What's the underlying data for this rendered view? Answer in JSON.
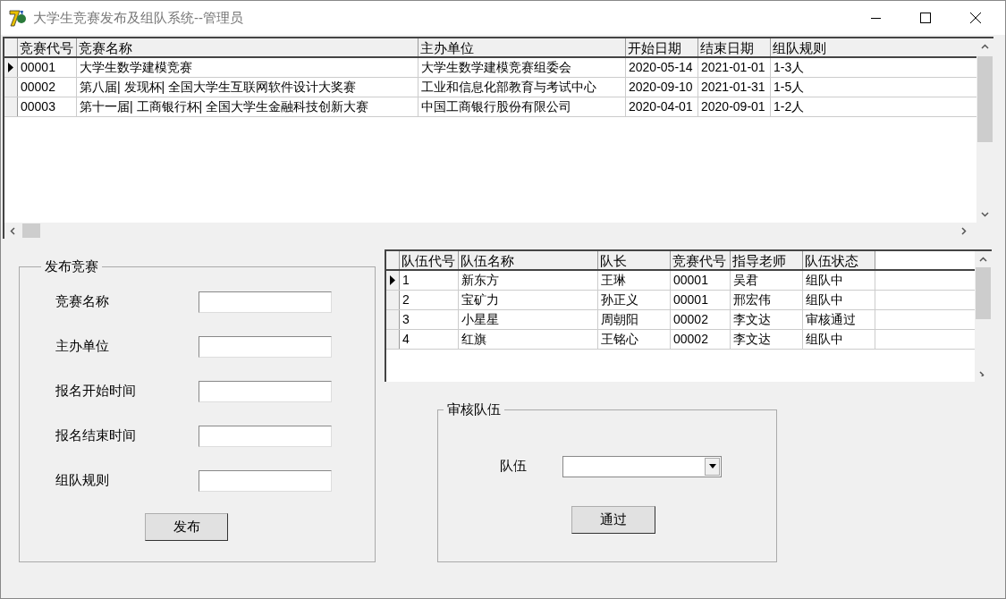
{
  "window": {
    "title": "大学生竞赛发布及组队系统--管理员"
  },
  "competitions_table": {
    "columns": [
      "竞赛代号",
      "竞赛名称",
      "主办单位",
      "开始日期",
      "结束日期",
      "组队规则"
    ],
    "rows": [
      {
        "selected": true,
        "cells": [
          "00001",
          "大学生数学建模竞赛",
          "大学生数学建模竞赛组委会",
          "2020-05-14",
          "2021-01-01",
          "1-3人"
        ]
      },
      {
        "selected": false,
        "cells": [
          "00002",
          "第八届| 发现杯| 全国大学生互联网软件设计大奖赛",
          "工业和信息化部教育与考试中心",
          "2020-09-10",
          "2021-01-31",
          "1-5人"
        ]
      },
      {
        "selected": false,
        "cells": [
          "00003",
          "第十一届| 工商银行杯| 全国大学生金融科技创新大赛",
          "中国工商银行股份有限公司",
          "2020-04-01",
          "2020-09-01",
          "1-2人"
        ]
      }
    ]
  },
  "publish_group": {
    "title": "发布竞赛",
    "fields": [
      {
        "label": "竞赛名称"
      },
      {
        "label": "主办单位"
      },
      {
        "label": "报名开始时间"
      },
      {
        "label": "报名结束时间"
      },
      {
        "label": "组队规则"
      }
    ],
    "button": "发布"
  },
  "teams_table": {
    "columns": [
      "队伍代号",
      "队伍名称",
      "队长",
      "竞赛代号",
      "指导老师",
      "队伍状态"
    ],
    "rows": [
      {
        "selected": true,
        "cells": [
          "1",
          "新东方",
          "王琳",
          "00001",
          "吴君",
          "组队中"
        ]
      },
      {
        "selected": false,
        "cells": [
          "2",
          "宝矿力",
          "孙正义",
          "00001",
          "邢宏伟",
          "组队中"
        ]
      },
      {
        "selected": false,
        "cells": [
          "3",
          "小星星",
          "周朝阳",
          "00002",
          "李文达",
          "审核通过"
        ]
      },
      {
        "selected": false,
        "cells": [
          "4",
          "红旗",
          "王铭心",
          "00002",
          "李文达",
          "组队中"
        ]
      }
    ]
  },
  "review_group": {
    "title": "审核队伍",
    "label": "队伍",
    "button": "通过"
  }
}
